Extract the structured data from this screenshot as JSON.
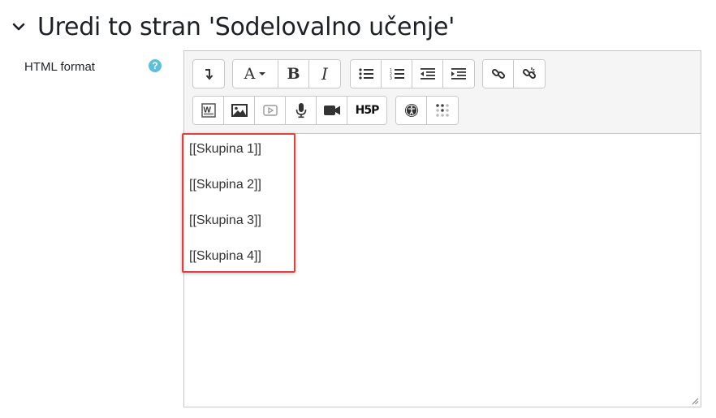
{
  "page": {
    "title": "Uredi to stran 'Sodelovalno učenje'"
  },
  "field": {
    "label": "HTML format",
    "help_icon": "question-circle-icon"
  },
  "toolbar": {
    "row1": [
      [
        "collapse-toolbar-icon"
      ],
      [
        "font-style-icon",
        "bold-icon",
        "italic-icon"
      ],
      [
        "unordered-list-icon",
        "ordered-list-icon",
        "outdent-icon",
        "indent-icon"
      ],
      [
        "link-icon",
        "unlink-icon"
      ]
    ],
    "row2": [
      [
        "word-import-icon",
        "image-icon",
        "media-icon",
        "record-audio-icon",
        "record-video-icon",
        "h5p-icon"
      ],
      [
        "accessibility-checker-icon",
        "screenreader-helper-icon"
      ]
    ],
    "bold_label": "B",
    "italic_label": "I",
    "font_label": "A",
    "h5p_label": "H5P"
  },
  "content": {
    "paragraphs": [
      "[[Skupina 1]]",
      "[[Skupina 2]]",
      "[[Skupina 3]]",
      "[[Skupina 4]]"
    ]
  },
  "colors": {
    "highlight_border": "#e0413d",
    "help_icon": "#5bc0de",
    "toolbar_bg": "#f5f5f5",
    "border": "#c8c8c8"
  }
}
